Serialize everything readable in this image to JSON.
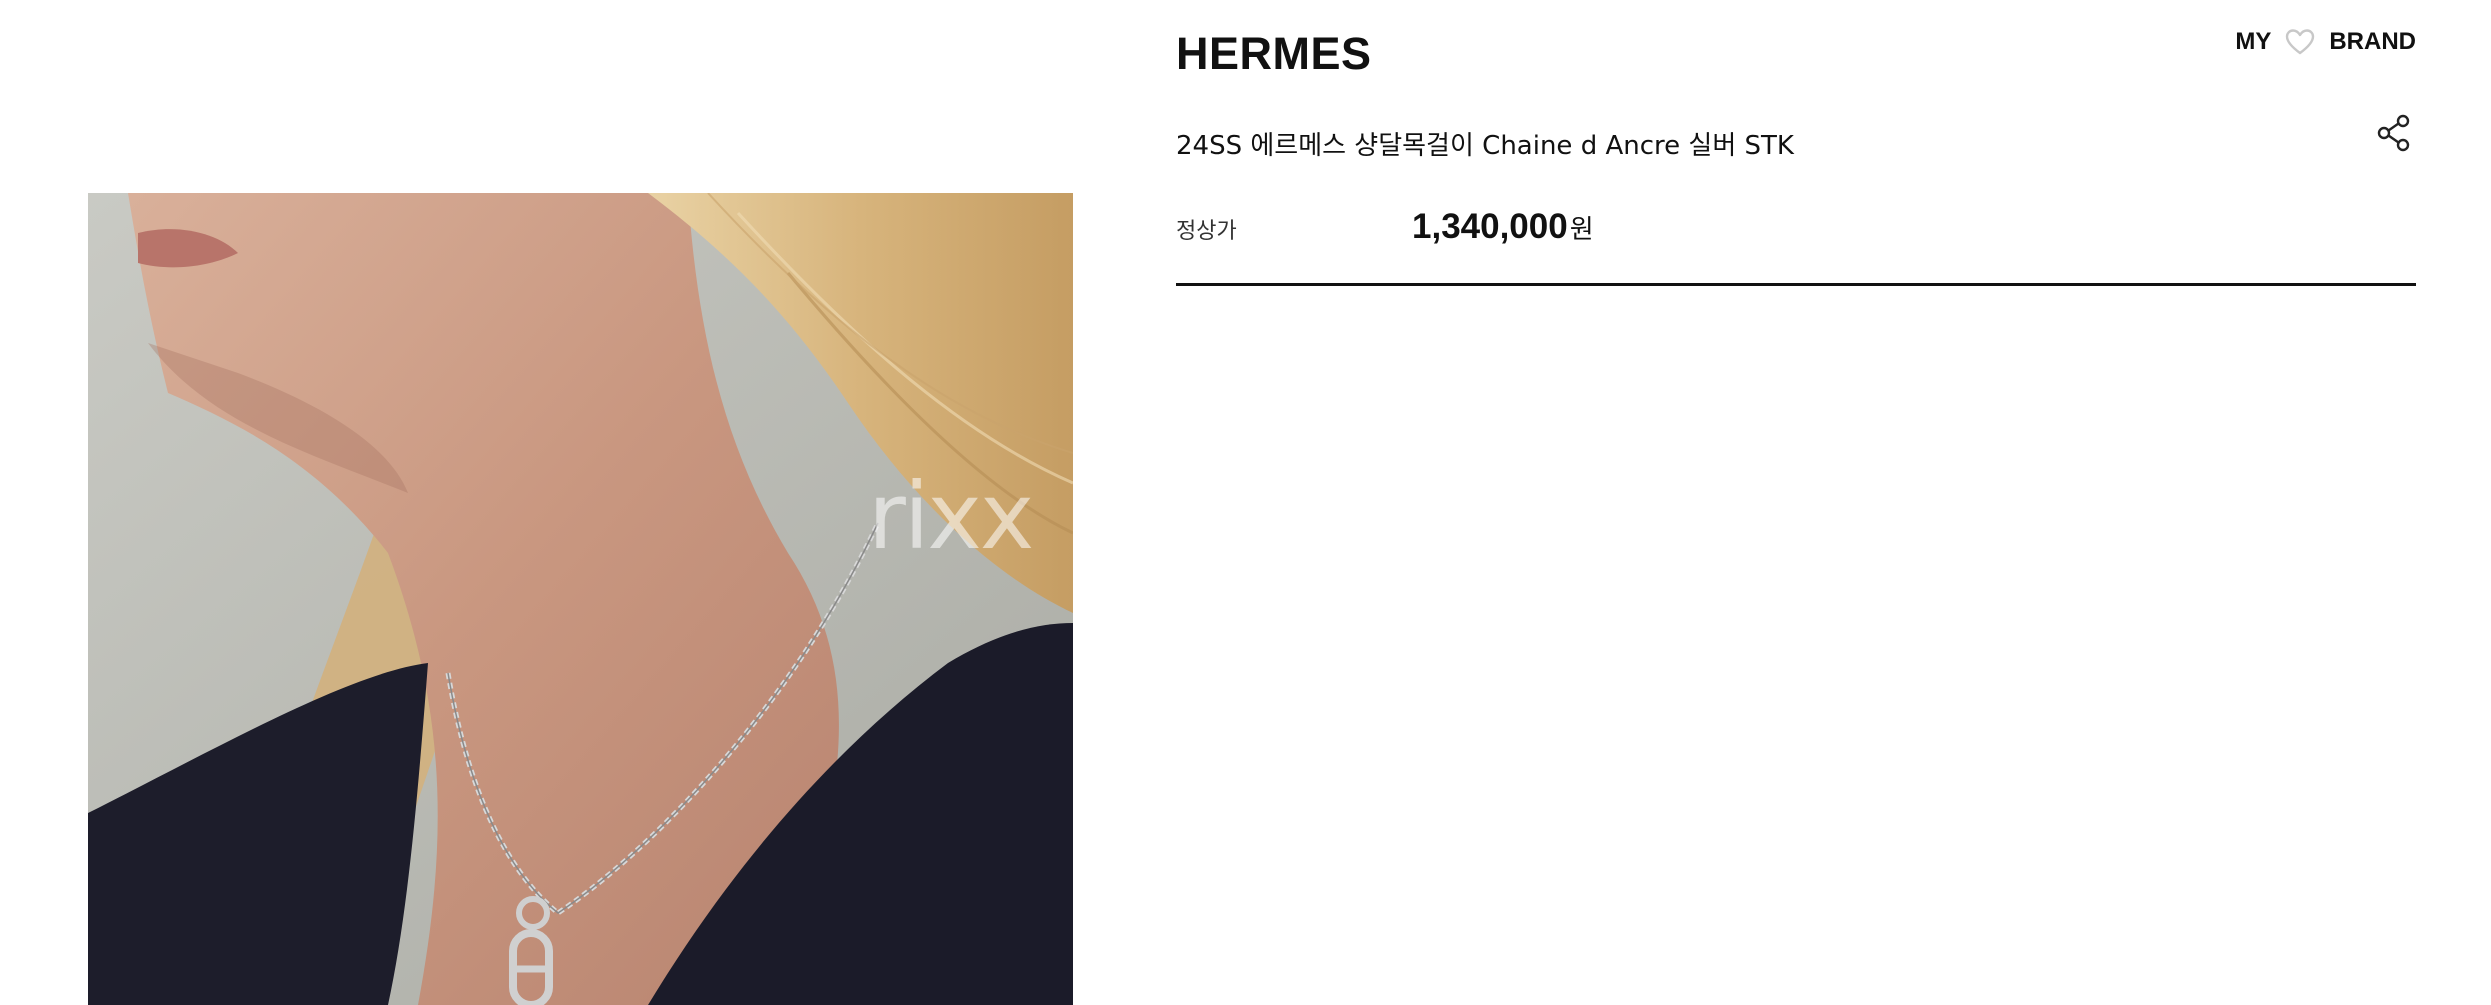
{
  "product": {
    "brand": "HERMES",
    "name": "24SS 에르메스 샹달목걸이 Chaine d Ancre 실버 STK",
    "price_label": "정상가",
    "price_amount": "1,340,000",
    "price_currency": "원"
  },
  "header": {
    "my_label": "MY",
    "brand_label": "BRAND",
    "heart_icon": "heart-outline-icon",
    "share_icon": "share-icon"
  },
  "image": {
    "watermark": "rixx"
  },
  "colors": {
    "text": "#111111",
    "heart": "#c8c8c8"
  }
}
